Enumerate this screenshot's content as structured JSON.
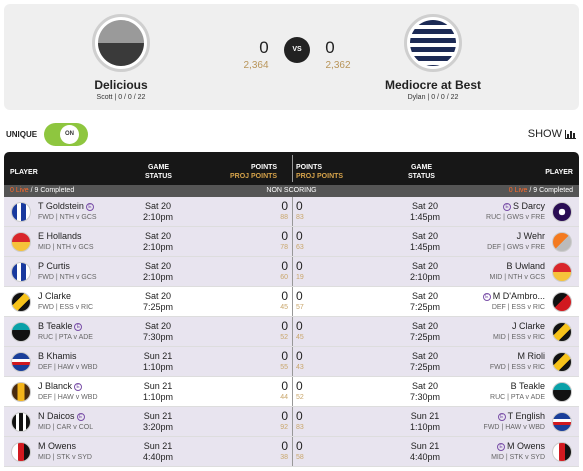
{
  "home": {
    "name": "Delicious",
    "coach": "Scott",
    "record": "0 / 0 / 22",
    "score": "0",
    "proj": "2,364"
  },
  "away": {
    "name": "Mediocre at Best",
    "coach": "Dylan",
    "record": "0 / 0 / 22",
    "score": "0",
    "proj": "2,362"
  },
  "vs_label": "VS",
  "unique_label": "UNIQUE",
  "toggle_label": "ON",
  "show_label": "SHOW",
  "headers": {
    "player": "PLAYER",
    "game": "GAME",
    "status": "STATUS",
    "points": "POINTS",
    "proj_points": "PROJ POINTS"
  },
  "subheader": {
    "live_left": "0 Live",
    "completed_left": "/ 9 Completed",
    "nonscoring": "NON SCORING",
    "live_right": "0 Live",
    "completed_right": "/ 9 Completed"
  },
  "rows": [
    {
      "l_name": "T Goldstein",
      "l_e": true,
      "l_meta": "FWD | NTH v GCS",
      "l_bold": "NTH",
      "l_day": "Sat 20",
      "l_time": "2:10pm",
      "l_pts": "0",
      "l_proj": "88",
      "r_proj": "83",
      "r_pts": "0",
      "r_day": "Sat 20",
      "r_time": "1:45pm",
      "r_name": "S Darcy",
      "r_e": true,
      "r_meta": "RUC | GWS v FRE",
      "l_g": "nth",
      "r_g": "fre",
      "bg": "lav"
    },
    {
      "l_name": "E Hollands",
      "l_e": false,
      "l_meta": "MID | NTH v GCS",
      "l_day": "Sat 20",
      "l_time": "2:10pm",
      "l_pts": "0",
      "l_proj": "78",
      "r_proj": "63",
      "r_pts": "0",
      "r_day": "Sat 20",
      "r_time": "1:45pm",
      "r_name": "J Wehr",
      "r_e": false,
      "r_meta": "DEF | GWS v FRE",
      "l_g": "gcs",
      "r_g": "gws",
      "bg": "lav"
    },
    {
      "l_name": "P Curtis",
      "l_e": false,
      "l_meta": "FWD | NTH v GCS",
      "l_day": "Sat 20",
      "l_time": "2:10pm",
      "l_pts": "0",
      "l_proj": "60",
      "r_proj": "19",
      "r_pts": "0",
      "r_day": "Sat 20",
      "r_time": "2:10pm",
      "r_name": "B Uwland",
      "r_e": false,
      "r_meta": "MID | NTH v GCS",
      "l_g": "nth",
      "r_g": "gcs",
      "bg": "lav"
    },
    {
      "l_name": "J Clarke",
      "l_e": false,
      "l_meta": "FWD | ESS v RIC",
      "l_day": "Sat 20",
      "l_time": "7:25pm",
      "l_pts": "0",
      "l_proj": "45",
      "r_proj": "57",
      "r_pts": "0",
      "r_day": "Sat 20",
      "r_time": "7:25pm",
      "r_name": "M D'Ambro...",
      "r_e": true,
      "r_meta": "DEF | ESS v RIC",
      "l_g": "ric",
      "r_g": "ess",
      "bg": "white"
    },
    {
      "l_name": "B Teakle",
      "l_e": true,
      "l_meta": "RUC | PTA v ADE",
      "l_day": "Sat 20",
      "l_time": "7:30pm",
      "l_pts": "0",
      "l_proj": "52",
      "r_proj": "45",
      "r_pts": "0",
      "r_day": "Sat 20",
      "r_time": "7:25pm",
      "r_name": "J Clarke",
      "r_e": false,
      "r_meta": "MID | ESS v RIC",
      "l_g": "pta",
      "r_g": "ric",
      "bg": "lav"
    },
    {
      "l_name": "B Khamis",
      "l_e": false,
      "l_meta": "DEF | HAW v WBD",
      "l_day": "Sun 21",
      "l_time": "1:10pm",
      "l_pts": "0",
      "l_proj": "55",
      "r_proj": "43",
      "r_pts": "0",
      "r_day": "Sat 20",
      "r_time": "7:25pm",
      "r_name": "M Rioli",
      "r_e": false,
      "r_meta": "FWD | ESS v RIC",
      "l_g": "wbd",
      "r_g": "ric",
      "bg": "lav"
    },
    {
      "l_name": "J Blanck",
      "l_e": true,
      "l_meta": "DEF | HAW v WBD",
      "l_day": "Sun 21",
      "l_time": "1:10pm",
      "l_pts": "0",
      "l_proj": "44",
      "r_proj": "52",
      "r_pts": "0",
      "r_day": "Sat 20",
      "r_time": "7:30pm",
      "r_name": "B Teakle",
      "r_e": false,
      "r_meta": "RUC | PTA v ADE",
      "l_g": "haw",
      "r_g": "pta",
      "bg": "white"
    },
    {
      "l_name": "N Daicos",
      "l_e": true,
      "l_meta": "MID | CAR v COL",
      "l_day": "Sun 21",
      "l_time": "3:20pm",
      "l_pts": "0",
      "l_proj": "92",
      "r_proj": "83",
      "r_pts": "0",
      "r_day": "Sun 21",
      "r_time": "1:10pm",
      "r_name": "T English",
      "r_e": true,
      "r_meta": "FWD | HAW v WBD",
      "l_g": "col",
      "r_g": "wbd",
      "bg": "lav"
    },
    {
      "l_name": "M Owens",
      "l_e": false,
      "l_meta": "MID | STK v SYD",
      "l_day": "Sun 21",
      "l_time": "4:40pm",
      "l_pts": "0",
      "l_proj": "38",
      "r_proj": "58",
      "r_pts": "0",
      "r_day": "Sun 21",
      "r_time": "4:40pm",
      "r_name": "M Owens",
      "r_e": true,
      "r_meta": "MID | STK v SYD",
      "l_g": "stk",
      "r_g": "stk",
      "bg": "lav"
    }
  ]
}
